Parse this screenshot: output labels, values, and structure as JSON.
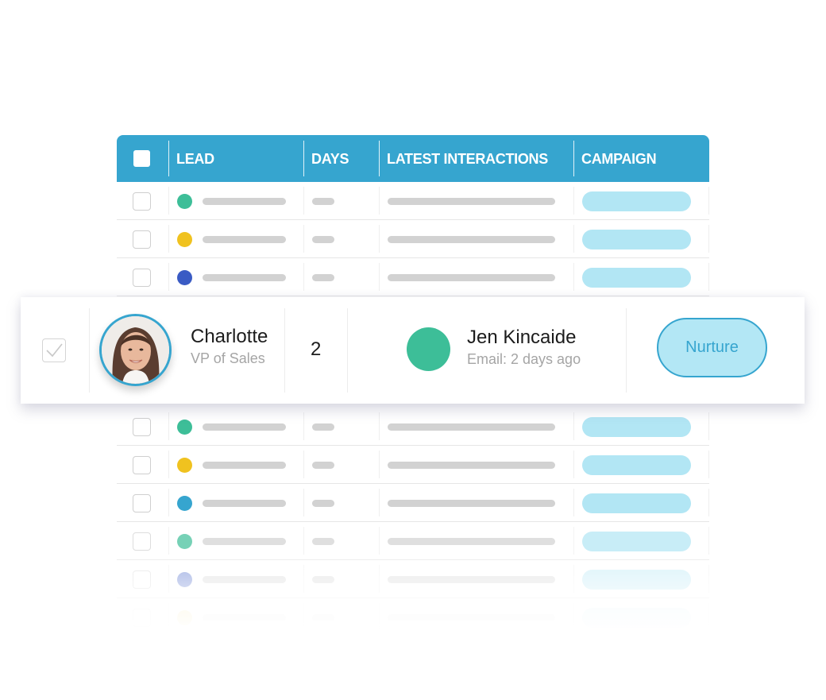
{
  "table": {
    "columns": [
      {
        "label": "LEAD"
      },
      {
        "label": "DAYS"
      },
      {
        "label": "LATEST INTERACTIONS"
      },
      {
        "label": "CAMPAIGN"
      }
    ],
    "colors": {
      "header": "#36a5cf",
      "placeholder_bar": "#d2d2d2",
      "campaign_pill": "#b2e6f4"
    },
    "placeholder_rows_above": [
      {
        "status_color": "#3dbe98",
        "opacity": 1
      },
      {
        "status_color": "#f0c21f",
        "opacity": 1
      },
      {
        "status_color": "#3a5bc4",
        "opacity": 1
      }
    ],
    "placeholder_rows_below": [
      {
        "status_color": "#3dbe98",
        "opacity": 1
      },
      {
        "status_color": "#f0c21f",
        "opacity": 1
      },
      {
        "status_color": "#36a5cf",
        "opacity": 1
      },
      {
        "status_color": "#3dbe98",
        "opacity": 0.7
      },
      {
        "status_color": "#3a5bc4",
        "opacity": 0.45
      },
      {
        "status_color": "#f0c21f",
        "opacity": 0.2
      }
    ]
  },
  "featured_row": {
    "checked": true,
    "lead": {
      "name": "Charlotte",
      "title": "VP of Sales",
      "avatar": "avatar-photo"
    },
    "days": "2",
    "interaction": {
      "contact": "Jen Kincaide",
      "detail": "Email: 2 days ago",
      "status_color": "#3dbe98"
    },
    "campaign": "Nurture"
  }
}
